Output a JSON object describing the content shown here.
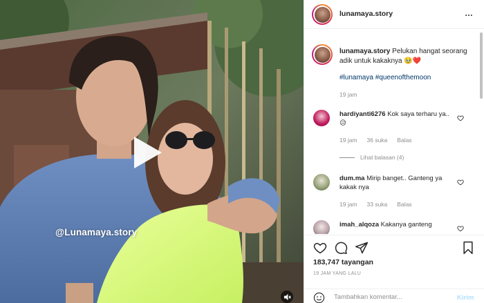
{
  "post": {
    "username": "lunamaya.story",
    "more_label": "…",
    "caption_text": "Pelukan hangat seorang adik untuk kakaknya 🥹❤️",
    "hashtags": "#lunamaya #queenofthemoon",
    "caption_time": "19 jam"
  },
  "media": {
    "watermark": "@Lunamaya.story"
  },
  "comments": [
    {
      "username": "hardiyanti6276",
      "text": "Kok saya terharu ya..😥",
      "time": "19 jam",
      "likes": "36 suka",
      "reply": "Balas",
      "view_replies": "Lihat balasan (4)"
    },
    {
      "username": "dum.ma",
      "text": "Mirip banget.. Ganteng ya kakak nya",
      "time": "19 jam",
      "likes": "33 suka",
      "reply": "Balas"
    },
    {
      "username": "imah_alqoza",
      "text": "Kakanya ganteng",
      "time": "",
      "likes": "",
      "reply": ""
    }
  ],
  "stats": {
    "views": "183,747 tayangan",
    "time_ago": "19 JAM YANG LALU"
  },
  "add_comment": {
    "placeholder": "Tambahkan komentar...",
    "send_label": "Kirim"
  },
  "icons": {
    "like": "heart-icon",
    "comment": "comment-icon",
    "share": "paper-plane-icon",
    "save": "bookmark-icon",
    "play": "play-icon",
    "mute": "muted-speaker-icon",
    "emoji": "smiley-icon"
  },
  "colors": {
    "link": "#00376b",
    "muted": "#8e8e8e",
    "send_disabled": "#b2dffc"
  }
}
